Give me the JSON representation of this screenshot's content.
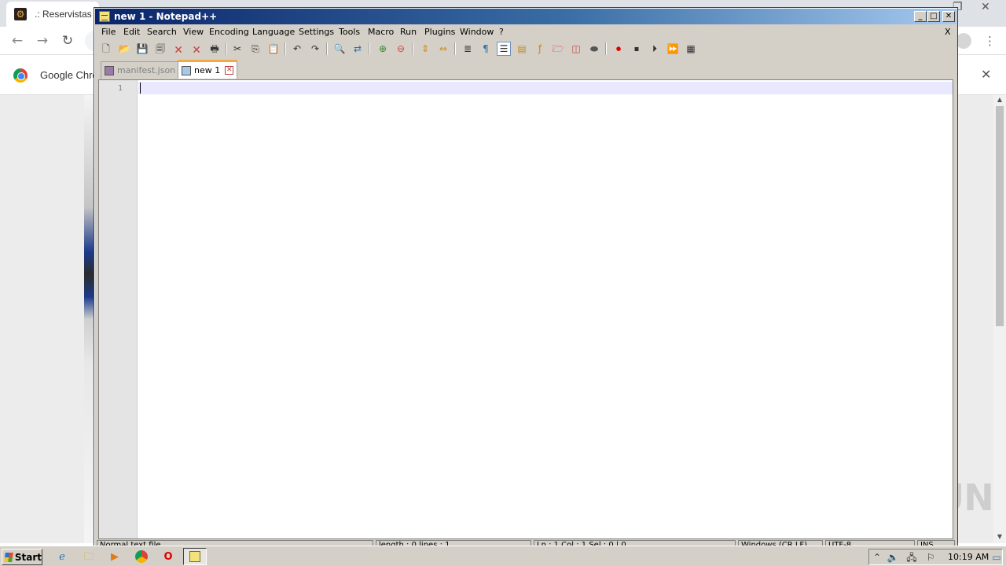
{
  "chrome": {
    "tab_title": ".: Reservistas UNAC",
    "infobar_text": "Google Chrome"
  },
  "notepad": {
    "title": "new 1 - Notepad++",
    "menu": [
      "File",
      "Edit",
      "Search",
      "View",
      "Encoding",
      "Language",
      "Settings",
      "Tools",
      "Macro",
      "Run",
      "Plugins",
      "Window",
      "?"
    ],
    "menu_close": "X",
    "tabs": [
      {
        "label": "manifest.json",
        "active": false
      },
      {
        "label": "new 1",
        "active": true
      }
    ],
    "line_numbers": [
      "1"
    ],
    "status": {
      "type": "Normal text file",
      "length": "length : 0   lines : 1",
      "position": "Ln : 1   Col : 1   Sel : 0 | 0",
      "eol": "Windows (CR LF)",
      "encoding": "UTF-8",
      "mode": "INS"
    }
  },
  "watermark": "ANY RUN",
  "taskbar": {
    "start_label": "Start",
    "clock": "10:19 AM"
  },
  "colors": {
    "titlebar_start": "#0a246a",
    "titlebar_end": "#a6caf0",
    "active_tab_accent": "#f7a840",
    "current_line": "#e8e8ff"
  }
}
